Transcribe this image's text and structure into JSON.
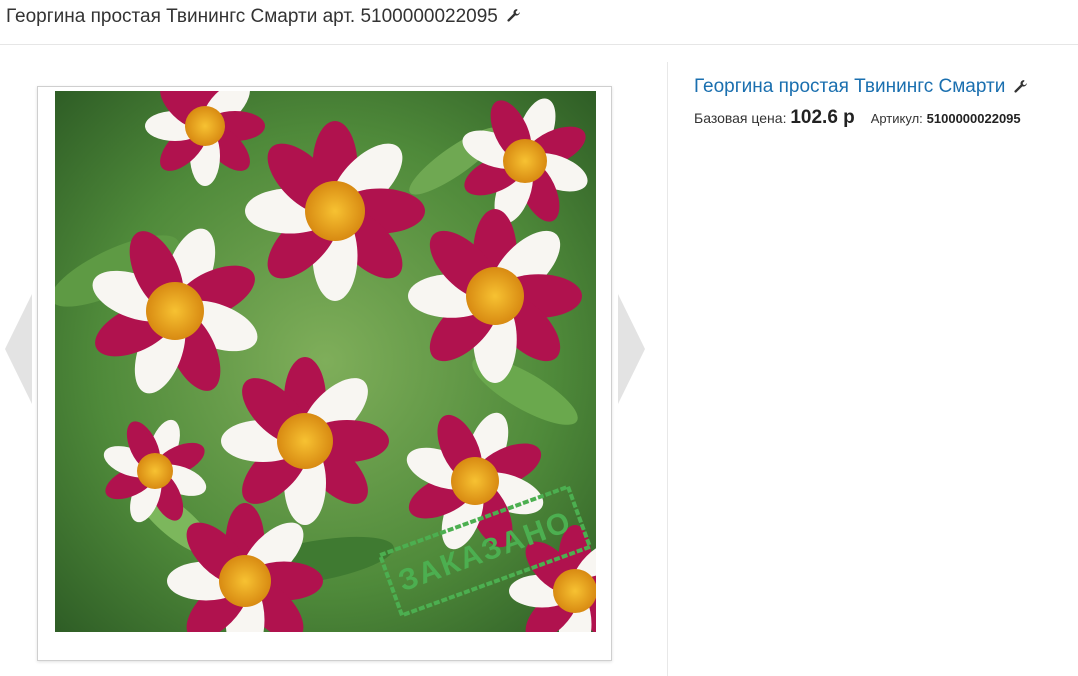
{
  "header": {
    "title": "Георгина простая Твинингс Смарти арт. 5100000022095",
    "edit_icon": "wrench-icon"
  },
  "gallery": {
    "stamp_text": "ЗАКАЗАНО",
    "prev_icon": "chevron-left-icon",
    "next_icon": "chevron-right-icon"
  },
  "product": {
    "name": "Георгина простая Твинингс Смарти",
    "edit_icon": "wrench-icon",
    "base_price_label": "Базовая цена:",
    "base_price_value": "102.6 р",
    "article_label": "Артикул:",
    "article_value": "5100000022095"
  },
  "colors": {
    "link": "#1a6faf",
    "stamp": "#4caf50"
  }
}
